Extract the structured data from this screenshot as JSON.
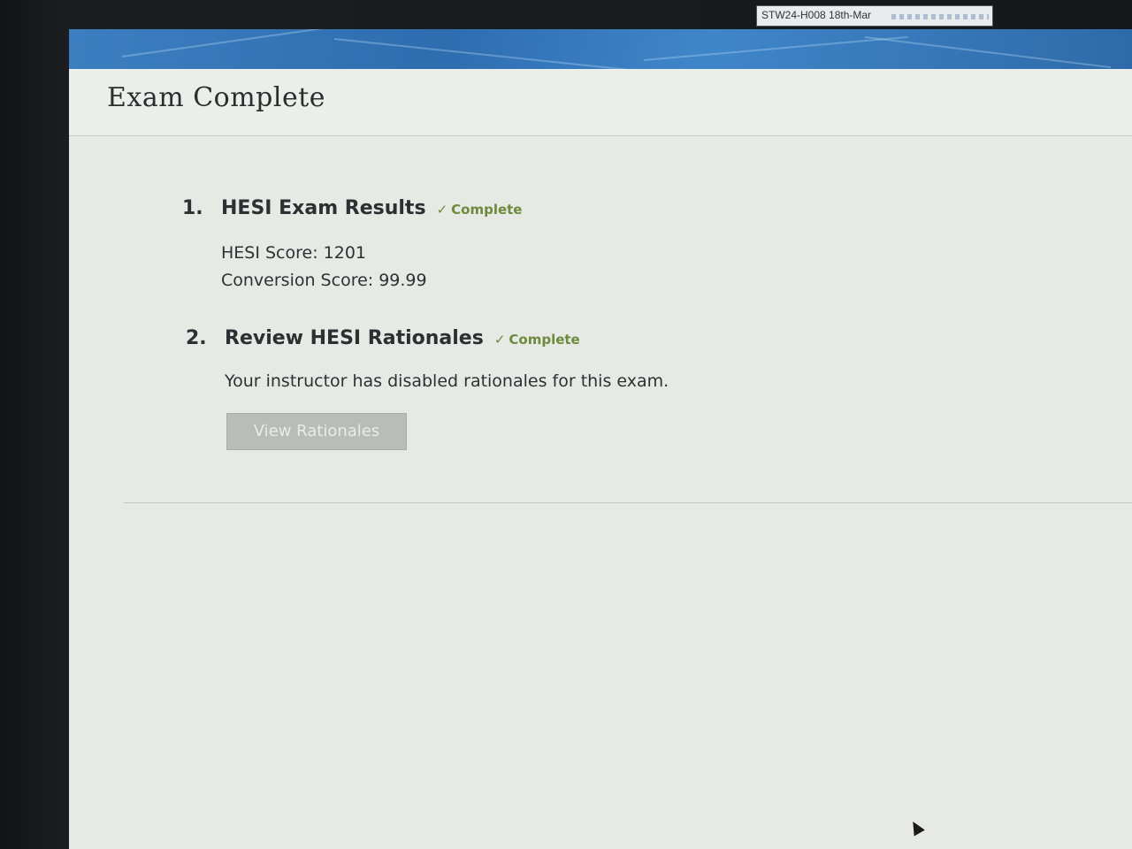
{
  "top_strip": {
    "label": "STW24-H008 18th-Mar"
  },
  "page": {
    "title": "Exam Complete"
  },
  "steps": [
    {
      "number": "1.",
      "title": "HESI Exam Results",
      "status": "Complete",
      "lines": [
        "HESI Score: 1201",
        "Conversion Score: 99.99"
      ]
    },
    {
      "number": "2.",
      "title": "Review HESI Rationales",
      "status": "Complete",
      "lines": [
        "Your instructor has disabled rationales for this exam."
      ],
      "button_label": "View Rationales",
      "button_disabled": true
    }
  ],
  "icons": {
    "check": "check-icon",
    "cursor": "mouse-pointer-icon"
  },
  "colors": {
    "banner": "#2d6db0",
    "complete_green": "#6f8a3c",
    "disabled_button": "#b9bcb7"
  }
}
